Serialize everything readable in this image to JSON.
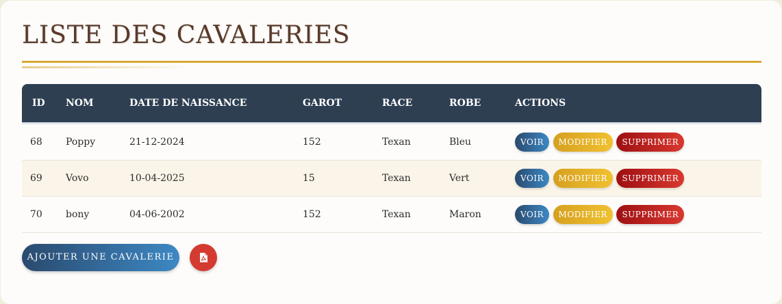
{
  "page": {
    "title": "LISTE DES CAVALERIES"
  },
  "table": {
    "headers": [
      "ID",
      "NOM",
      "DATE DE NAISSANCE",
      "GAROT",
      "RACE",
      "ROBE",
      "ACTIONS"
    ],
    "rows": [
      {
        "id": "68",
        "nom": "Poppy",
        "date": "21-12-2024",
        "garot": "152",
        "race": "Texan",
        "robe": "Bleu"
      },
      {
        "id": "69",
        "nom": "Vovo",
        "date": "10-04-2025",
        "garot": "15",
        "race": "Texan",
        "robe": "Vert"
      },
      {
        "id": "70",
        "nom": "bony",
        "date": "04-06-2002",
        "garot": "152",
        "race": "Texan",
        "robe": "Maron"
      }
    ],
    "actions": {
      "view": "VOIR",
      "edit": "MODIFIER",
      "delete": "SUPPRIMER"
    }
  },
  "footer": {
    "add_label": "AJOUTER UNE CAVALERIE",
    "pdf_icon": "file-pdf-icon"
  },
  "colors": {
    "header_bg": "#2e3f52",
    "accent_gold": "#d7a830",
    "title": "#5a3a2a",
    "danger": "#d43a2f"
  }
}
